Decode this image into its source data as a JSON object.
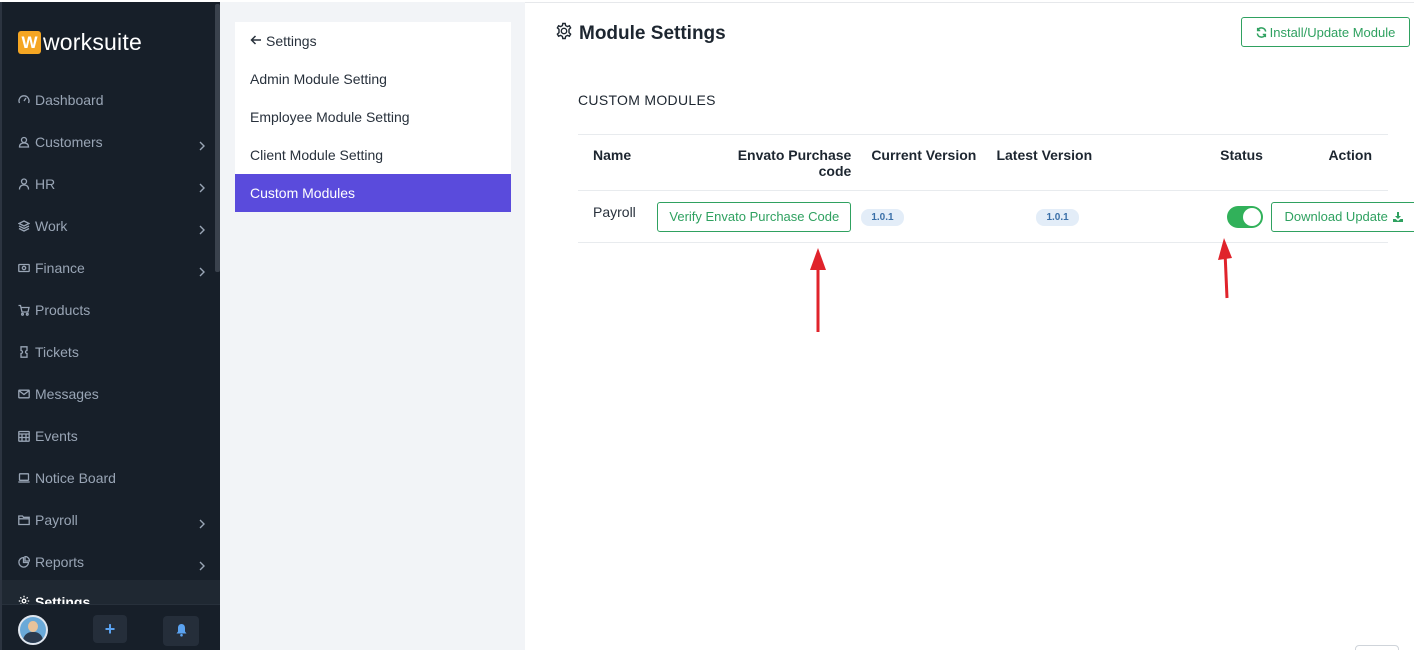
{
  "sidebar": {
    "brand": {
      "letter": "W",
      "name": "worksuite"
    },
    "items": [
      {
        "label": "Dashboard",
        "icon": "dashboard-icon",
        "chevron": false
      },
      {
        "label": "Customers",
        "icon": "user-icon",
        "chevron": true
      },
      {
        "label": "HR",
        "icon": "person-icon",
        "chevron": true
      },
      {
        "label": "Work",
        "icon": "layers-icon",
        "chevron": true
      },
      {
        "label": "Finance",
        "icon": "money-icon",
        "chevron": true
      },
      {
        "label": "Products",
        "icon": "cart-icon",
        "chevron": false
      },
      {
        "label": "Tickets",
        "icon": "ticket-icon",
        "chevron": false
      },
      {
        "label": "Messages",
        "icon": "envelope-icon",
        "chevron": false
      },
      {
        "label": "Events",
        "icon": "calendar-icon",
        "chevron": false
      },
      {
        "label": "Notice Board",
        "icon": "laptop-icon",
        "chevron": false
      },
      {
        "label": "Payroll",
        "icon": "folder-icon",
        "chevron": true
      },
      {
        "label": "Reports",
        "icon": "pie-chart-icon",
        "chevron": true
      },
      {
        "label": "Settings",
        "icon": "gear-icon",
        "chevron": false
      }
    ],
    "footer": {
      "add_symbol": "+",
      "bell_icon": "bell-icon"
    }
  },
  "settings_menu": {
    "back_label": "Settings",
    "items": [
      "Admin Module Setting",
      "Employee Module Setting",
      "Client Module Setting",
      "Custom Modules"
    ],
    "active": "Custom Modules"
  },
  "main": {
    "title": "Module Settings",
    "install_button": "Install/Update Module",
    "section_title": "CUSTOM MODULES",
    "table": {
      "headers": {
        "name": "Name",
        "code_line1": "Envato Purchase",
        "code_line2": "code",
        "current": "Current Version",
        "latest": "Latest Version",
        "status": "Status",
        "action": "Action"
      },
      "rows": [
        {
          "name": "Payroll",
          "verify_button": "Verify Envato Purchase Code",
          "current_version": "1.0.1",
          "latest_version": "1.0.1",
          "status_enabled": true,
          "action_button": "Download Update"
        }
      ]
    }
  },
  "colors": {
    "sidebar_bg": "#171f29",
    "active_menu": "#5a4bdc",
    "accent_green": "#2fa160",
    "toggle_on": "#31b15a",
    "annotation_arrow": "#e0232b"
  }
}
